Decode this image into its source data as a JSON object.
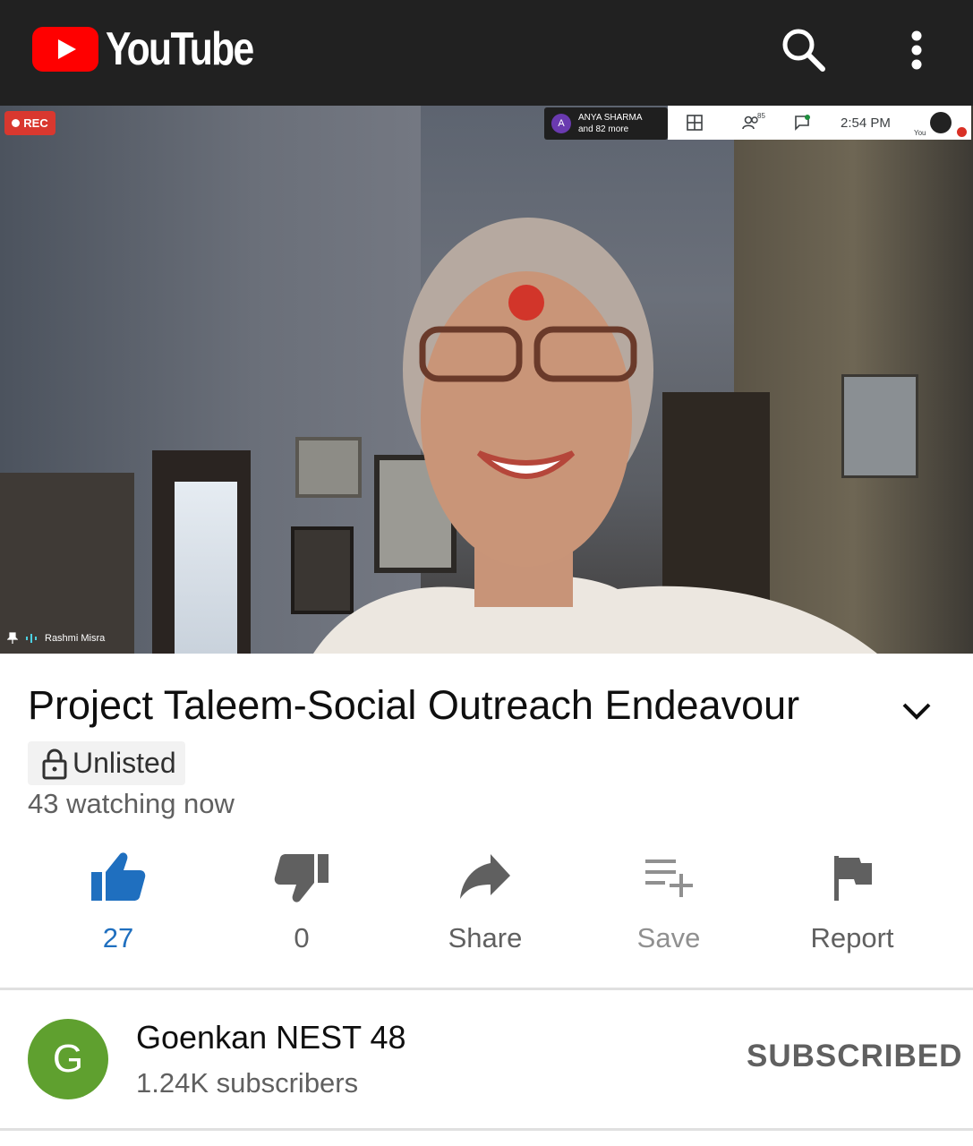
{
  "header": {
    "logo_text": "YouTube",
    "search_icon": "search-icon",
    "menu_icon": "more-vertical-icon"
  },
  "video": {
    "rec_label": "REC",
    "participant": {
      "avatar_letter": "A",
      "line1": "ANYA SHARMA",
      "line2": "and 82 more"
    },
    "participant_count": "85",
    "time": "2:54 PM",
    "self_label": "You",
    "speaker_name": "Rashmi Misra"
  },
  "info": {
    "title": "Project Taleem-Social Outreach Endeavour",
    "privacy": "Unlisted",
    "watching": "43 watching now"
  },
  "actions": {
    "like_count": "27",
    "dislike_count": "0",
    "share_label": "Share",
    "save_label": "Save",
    "report_label": "Report",
    "like_color": "#1f6fbf"
  },
  "channel": {
    "avatar_letter": "G",
    "name": "Goenkan NEST 48",
    "subscribers": "1.24K subscribers",
    "subscribe_label": "SUBSCRIBED",
    "avatar_color": "#5fa02f"
  }
}
